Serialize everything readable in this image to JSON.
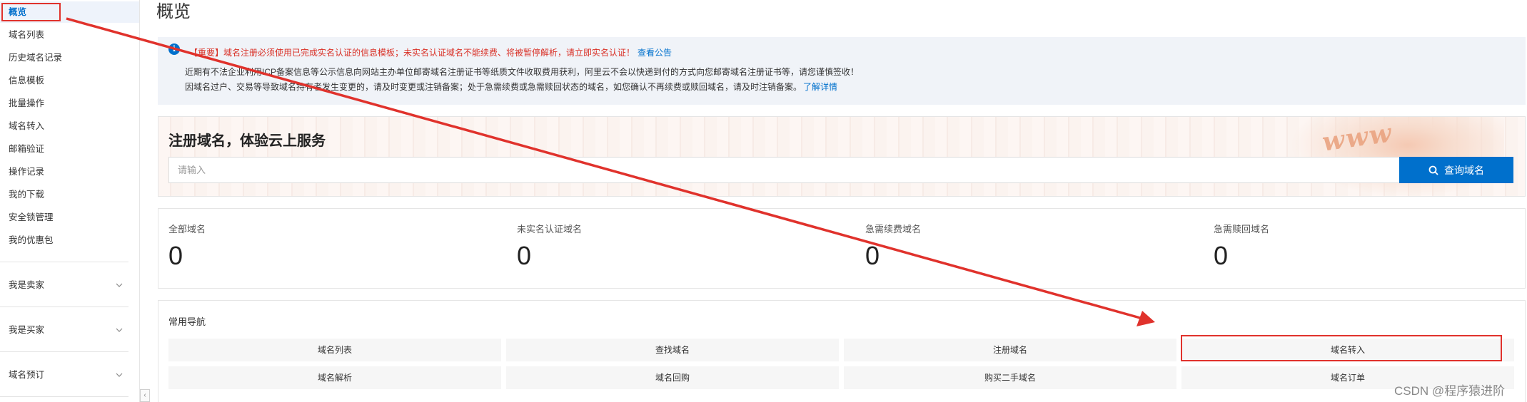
{
  "sidebar": {
    "items": [
      {
        "label": "概览"
      },
      {
        "label": "域名列表"
      },
      {
        "label": "历史域名记录"
      },
      {
        "label": "信息模板"
      },
      {
        "label": "批量操作"
      },
      {
        "label": "域名转入"
      },
      {
        "label": "邮箱验证"
      },
      {
        "label": "操作记录"
      },
      {
        "label": "我的下载"
      },
      {
        "label": "安全锁管理"
      },
      {
        "label": "我的优惠包"
      }
    ],
    "groups": [
      {
        "label": "我是卖家"
      },
      {
        "label": "我是买家"
      },
      {
        "label": "域名预订"
      }
    ]
  },
  "page": {
    "title": "概览"
  },
  "notice": {
    "line1": "【重要】域名注册必须使用已完成实名认证的信息模板；未实名认证域名不能续费、将被暂停解析，请立即实名认证！",
    "line1_link": "查看公告",
    "line2": "近期有不法企业利用ICP备案信息等公示信息向网站主办单位邮寄域名注册证书等纸质文件收取费用获利，阿里云不会以快递到付的方式向您邮寄域名注册证书等，请您谨慎签收！",
    "line3": "因域名过户、交易等导致域名持有者发生变更的，请及时变更或注销备案；处于急需续费或急需赎回状态的域名，如您确认不再续费或赎回域名，请及时注销备案。",
    "line3_link": "了解详情"
  },
  "banner": {
    "title": "注册域名，体验云上服务",
    "search_placeholder": "请输入",
    "search_button": "查询域名",
    "decoration_text": "www"
  },
  "stats": [
    {
      "label": "全部域名",
      "value": "0"
    },
    {
      "label": "未实名认证域名",
      "value": "0"
    },
    {
      "label": "急需续费域名",
      "value": "0"
    },
    {
      "label": "急需赎回域名",
      "value": "0"
    }
  ],
  "quick_nav": {
    "title": "常用导航",
    "items": [
      {
        "label": "域名列表"
      },
      {
        "label": "查找域名"
      },
      {
        "label": "注册域名"
      },
      {
        "label": "域名转入"
      },
      {
        "label": "域名解析"
      },
      {
        "label": "域名回购"
      },
      {
        "label": "购买二手域名"
      },
      {
        "label": "域名订单"
      }
    ]
  },
  "annotation_color": "#e0322c",
  "accent_color": "#0070cc",
  "watermark": "CSDN @程序猿进阶",
  "collapse_handle": "‹"
}
